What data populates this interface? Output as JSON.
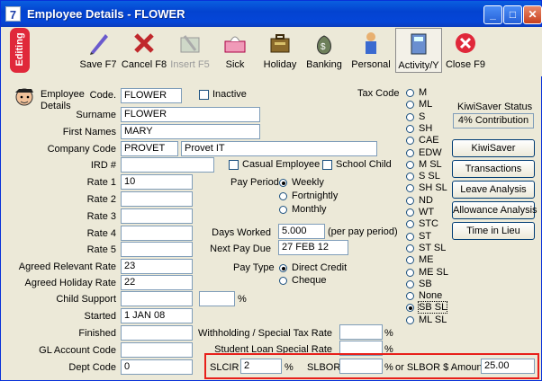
{
  "window": {
    "title": "Employee Details - FLOWER",
    "app_glyph": "7"
  },
  "toolbar": {
    "mode_label": "Editing",
    "buttons": [
      {
        "label": "Save F7",
        "icon": "pen-icon"
      },
      {
        "label": "Cancel F8",
        "icon": "cancel-x-icon"
      },
      {
        "label": "Insert F5",
        "icon": "insert-icon"
      },
      {
        "label": "Sick",
        "icon": "tissue-box-icon"
      },
      {
        "label": "Holiday",
        "icon": "suitcase-icon"
      },
      {
        "label": "Banking",
        "icon": "money-bag-icon"
      },
      {
        "label": "Personal",
        "icon": "person-icon"
      },
      {
        "label": "Activity/Y",
        "icon": "calculator-icon"
      },
      {
        "label": "Close F9",
        "icon": "close-circle-icon"
      }
    ]
  },
  "header": {
    "section_label": "Employee\nDetails"
  },
  "form": {
    "code_label": "Code.",
    "code": "FLOWER",
    "inactive_label": "Inactive",
    "surname_label": "Surname",
    "surname": "FLOWER",
    "first_names_label": "First Names",
    "first_names": "MARY",
    "company_code_label": "Company Code",
    "company_code": "PROVET",
    "company_name": "Provet IT",
    "ird_label": "IRD #",
    "ird": "",
    "casual_label": "Casual Employee",
    "school_child_label": "School Child",
    "rate1_label": "Rate 1",
    "rate1": "10",
    "rate2_label": "Rate 2",
    "rate2": "",
    "rate3_label": "Rate 3",
    "rate3": "",
    "rate4_label": "Rate 4",
    "rate4": "",
    "rate5_label": "Rate 5",
    "rate5": "",
    "agreed_relevant_label": "Agreed Relevant Rate",
    "agreed_relevant": "23",
    "agreed_holiday_label": "Agreed Holiday Rate",
    "agreed_holiday": "22",
    "child_support_label": "Child Support",
    "child_support": "",
    "child_support_pct": "",
    "pct": "%",
    "started_label": "Started",
    "started": "1 JAN 08",
    "finished_label": "Finished",
    "finished": "",
    "gl_label": "GL Account Code",
    "gl": "",
    "dept_label": "Dept Code",
    "dept": "0",
    "pay_period_label": "Pay Period",
    "pay_period_options": [
      "Weekly",
      "Fortnightly",
      "Monthly"
    ],
    "days_worked_label": "Days Worked",
    "days_worked": "5.000",
    "days_worked_note": "(per pay period)",
    "next_pay_label": "Next Pay Due",
    "next_pay": "27 FEB 12",
    "pay_type_label": "Pay Type",
    "pay_type_options": [
      "Direct Credit",
      "Cheque"
    ],
    "withholding_label": "Withholding / Special Tax Rate",
    "withholding": "",
    "student_loan_label": "Student Loan Special Rate",
    "student_loan": "",
    "slcir_label": "SLCIR",
    "slcir": "2",
    "slbor_label": "SLBOR",
    "slbor": "",
    "slbor_amount_label": "or SLBOR $ Amount",
    "slbor_amount": "25.00"
  },
  "tax": {
    "label": "Tax Code",
    "codes": [
      "M",
      "ML",
      "S",
      "SH",
      "CAE",
      "EDW",
      "M SL",
      "S SL",
      "SH SL",
      "ND",
      "WT",
      "STC",
      "ST",
      "ST SL",
      "ME",
      "ME SL",
      "SB",
      "None",
      "SB SL",
      "ML SL"
    ],
    "selected": "SB SL"
  },
  "kiwisaver": {
    "status_label": "KiwiSaver Status",
    "status": "4% Contribution"
  },
  "side_buttons": [
    "KiwiSaver",
    "Transactions",
    "Leave Analysis",
    "Allowance Analysis",
    "Time in Lieu"
  ],
  "colors": {
    "title_blue": "#0546d8",
    "editing_red": "#e0283a",
    "highlight_red": "#e8201a"
  }
}
